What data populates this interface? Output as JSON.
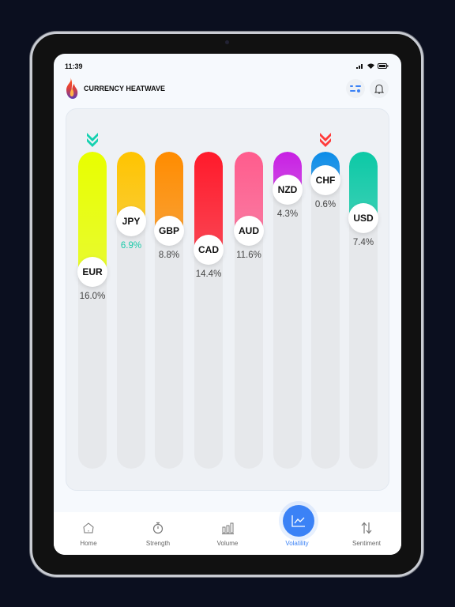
{
  "status": {
    "time": "11:39"
  },
  "app": {
    "title": "CURRENCY HEATWAVE"
  },
  "bars": [
    {
      "code": "EUR",
      "percent": "16.0%",
      "level": 0.38,
      "color": "#e8ff00",
      "pct_color": "#444444",
      "arrow": "down",
      "arrow_color": "#14d1b0"
    },
    {
      "code": "JPY",
      "percent": "6.9%",
      "level": 0.22,
      "color": "#ffc400",
      "pct_color": "#19c9a8"
    },
    {
      "code": "GBP",
      "percent": "8.8%",
      "level": 0.25,
      "color": "#ff8c00",
      "pct_color": "#444444"
    },
    {
      "code": "CAD",
      "percent": "14.4%",
      "level": 0.31,
      "color": "#ff1a2b",
      "pct_color": "#444444"
    },
    {
      "code": "AUD",
      "percent": "11.6%",
      "level": 0.25,
      "color": "#ff5c8d",
      "pct_color": "#444444"
    },
    {
      "code": "NZD",
      "percent": "4.3%",
      "level": 0.12,
      "color": "#c81fe3",
      "pct_color": "#444444"
    },
    {
      "code": "CHF",
      "percent": "0.6%",
      "level": 0.09,
      "color": "#0a8be8",
      "pct_color": "#444444",
      "arrow": "down",
      "arrow_color": "#ff3b3b"
    },
    {
      "code": "USD",
      "percent": "7.4%",
      "level": 0.21,
      "color": "#0cc9a6",
      "pct_color": "#444444"
    }
  ],
  "nav": [
    {
      "label": "Home",
      "icon": "home-icon"
    },
    {
      "label": "Strength",
      "icon": "stopwatch-icon"
    },
    {
      "label": "Volume",
      "icon": "bar-chart-icon"
    },
    {
      "label": "Volatility",
      "icon": "line-chart-icon",
      "active": true
    },
    {
      "label": "Sentiment",
      "icon": "up-down-arrows-icon"
    }
  ],
  "colors": {
    "accent": "#3b82f6"
  }
}
